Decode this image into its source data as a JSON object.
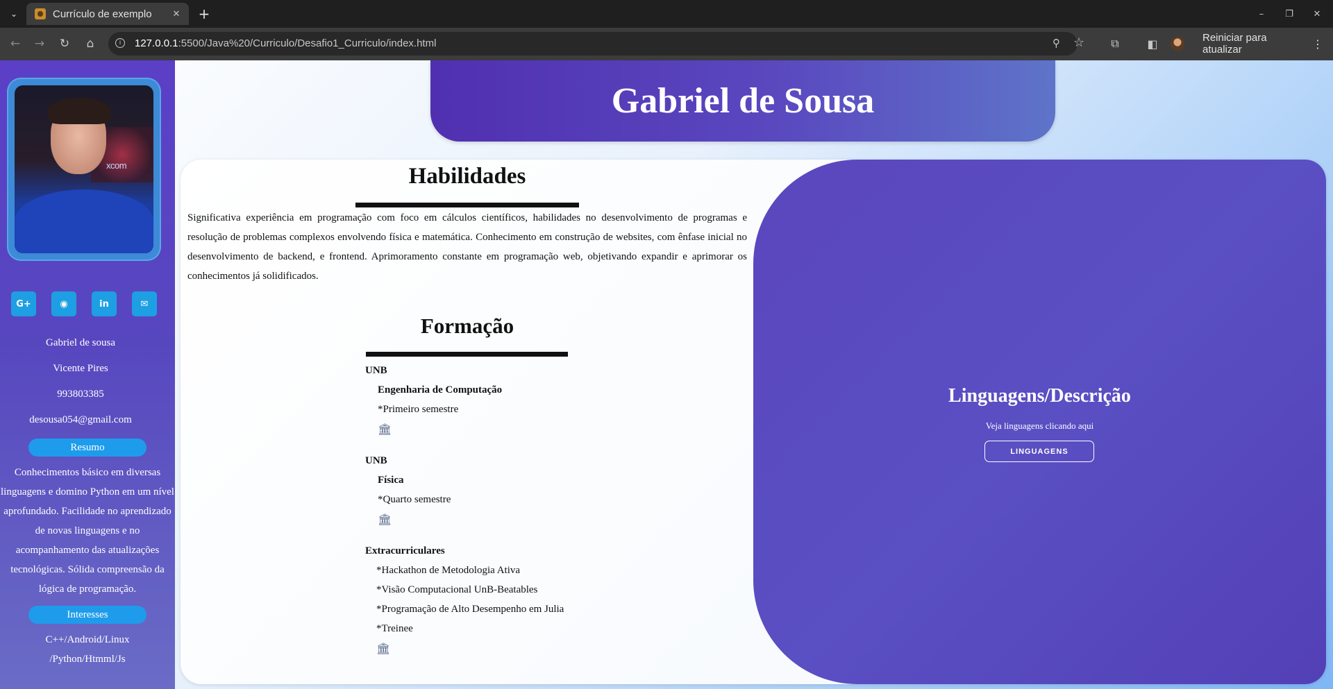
{
  "browser": {
    "tab_title": "Currículo de exemplo",
    "url_host": "127.0.0.1",
    "url_rest": ":5500/Java%20/Curriculo/Desafio1_Curriculo/index.html",
    "update_button": "Reiniciar para atualizar"
  },
  "sidebar": {
    "photo_logo_text": "xcom",
    "socials": [
      {
        "icon": "google-plus-icon",
        "glyph": "G+"
      },
      {
        "icon": "github-icon",
        "glyph": "◉"
      },
      {
        "icon": "linkedin-icon",
        "glyph": "in"
      },
      {
        "icon": "email-icon",
        "glyph": "✉"
      }
    ],
    "name": "Gabriel de sousa",
    "location": "Vicente Pires",
    "phone": "993803385",
    "email": "desousa054@gmail.com",
    "resumo_label": "Resumo",
    "resumo_lines": [
      "Conhecimentos básico em diversas",
      "linguagens e domino Python em um nível",
      "aprofundado. Facilidade no aprendizado",
      "de novas linguagens e no",
      "acompanhamento das atualizações",
      "tecnológicas. Sólida compreensão da",
      "lógica de programação."
    ],
    "interesses_label": "Interesses",
    "interesses_lines": [
      "C++/Android/Linux",
      "/Python/Htmml/Js"
    ]
  },
  "header": {
    "name": "Gabriel de Sousa"
  },
  "habilidades": {
    "title": "Habilidades",
    "text": "Significativa experiência em programação com foco em cálculos científicos, habilidades no desenvolvimento de programas e resolução de problemas complexos envolvendo física e matemática. Conhecimento em construção de websites, com ênfase inicial no desenvolvimento de backend, e frontend. Aprimoramento constante em programação web, objetivando expandir e aprimorar os conhecimentos já solidificados."
  },
  "formacao": {
    "title": "Formação",
    "blocks": [
      {
        "institution": "UNB",
        "course": "Engenharia de Computação",
        "item": "*Primeiro semestre"
      },
      {
        "institution": "UNB",
        "course": "Física",
        "item": "*Quarto semestre"
      }
    ],
    "extra_title": "Extracurriculares",
    "extra_items": [
      "*Hackathon de Metodologia Ativa",
      "*Visão Computacional UnB-Beatables",
      "*Programação de Alto Desempenho em Julia",
      "*Treinee"
    ]
  },
  "linguagens": {
    "title": "Linguagens/Descrição",
    "subtitle": "Veja linguagens clicando aqui",
    "button": "LINGUAGENS"
  }
}
